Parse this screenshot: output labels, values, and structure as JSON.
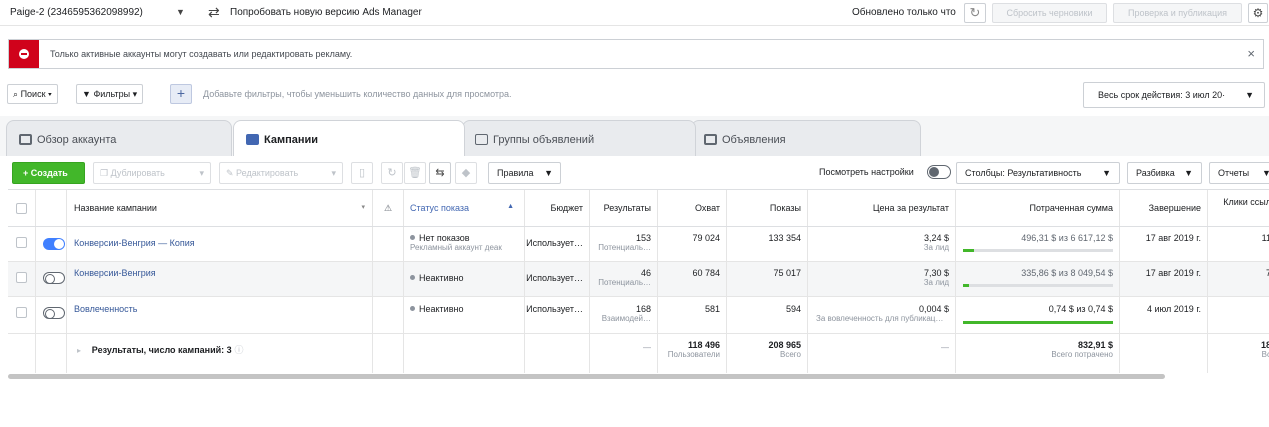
{
  "topbar": {
    "account": "Paige-2 (2346595362098992)",
    "try_link": "Попробовать новую версию Ads Manager",
    "updated": "Обновлено только что",
    "discard": "Сбросить черновики",
    "review": "Проверка и публикация"
  },
  "alert": {
    "text": "Только активные аккаунты могут создавать или редактировать рекламу.",
    "close": "×"
  },
  "filters": {
    "search": "Поиск",
    "filters": "Фильтры",
    "plus": "+",
    "hint": "Добавьте фильтры, чтобы уменьшить количество данных для просмотра.",
    "date_range": "Весь срок действия: 3 июл 20·"
  },
  "tabs": [
    {
      "label": "Обзор аккаунта"
    },
    {
      "label": "Кампании"
    },
    {
      "label": "Группы объявлений"
    },
    {
      "label": "Объявления"
    }
  ],
  "toolbar": {
    "create": "Создать",
    "duplicate": "Дублировать",
    "edit": "Редактировать",
    "rules": "Правила",
    "view_settings": "Посмотреть настройки",
    "columns": "Столбцы: Результативность",
    "breakdown": "Разбивка",
    "reports": "Отчеты"
  },
  "table": {
    "headers": {
      "name": "Название кампании",
      "status": "Статус показа",
      "budget": "Бюджет",
      "results": "Результаты",
      "reach": "Охват",
      "impressions": "Показы",
      "cost": "Цена за результат",
      "spent": "Потраченная сумма",
      "end": "Завершение",
      "clicks": "Клики ссыл"
    },
    "rows": [
      {
        "name": "Конверсии-Венгрия — Копия",
        "status": "Нет показов",
        "status_sub": "Рекламный аккаунт деак",
        "budget": "Использует…",
        "results": "153",
        "results_sub": "Потенциаль…",
        "reach": "79 024",
        "impressions": "133 354",
        "cost": "3,24 $",
        "cost_sub": "За лид",
        "spent": "496,31 $ из 6 617,12 $",
        "spent_progress": 0.075,
        "end": "17 авг 2019 г.",
        "clicks": "11"
      },
      {
        "name": "Конверсии-Венгрия",
        "status": "Неактивно",
        "status_sub": "",
        "budget": "Использует…",
        "results": "46",
        "results_sub": "Потенциаль…",
        "reach": "60 784",
        "impressions": "75 017",
        "cost": "7,30 $",
        "cost_sub": "За лид",
        "spent": "335,86 $ из 8 049,54 $",
        "spent_progress": 0.042,
        "end": "17 авг 2019 г.",
        "clicks": "7"
      },
      {
        "name": "Вовлеченность",
        "status": "Неактивно",
        "status_sub": "",
        "budget": "Использует…",
        "results": "168",
        "results_sub": "Взаимодей…",
        "reach": "581",
        "impressions": "594",
        "cost": "0,004 $",
        "cost_sub": "За вовлеченность для публикац…",
        "spent": "0,74 $ из 0,74 $",
        "spent_progress": 1.0,
        "end": "4 июл 2019 г.",
        "clicks": ""
      }
    ],
    "totals": {
      "label": "Результаты, число кампаний: 3",
      "results": "—",
      "reach": "118 496",
      "reach_sub": "Пользователи",
      "impressions": "208 965",
      "impressions_sub": "Всего",
      "cost": "—",
      "spent": "832,91 $",
      "spent_sub": "Всего потрачено",
      "clicks": "18",
      "clicks_sub": "Вс"
    }
  },
  "colors": {
    "alert_red": "#d0021b",
    "create_green": "#42b72a",
    "link_blue": "#365899",
    "toggle_on": "#4080ff"
  }
}
